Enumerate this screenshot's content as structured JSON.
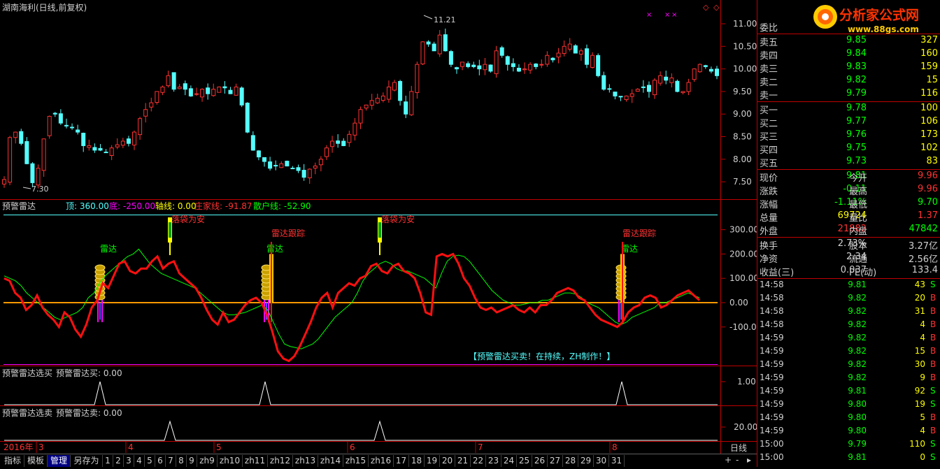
{
  "main_title": "湖南海利(日线,前复权)",
  "price_axis": [
    "11.00",
    "10.50",
    "10.00",
    "9.50",
    "9.00",
    "8.50",
    "8.00",
    "7.50"
  ],
  "price_high_label": "11.21",
  "price_low_label": "7.30",
  "radar": {
    "name": "预警雷达",
    "top_label": "顶: 360.00",
    "bottom_label": "底: -250.00",
    "axis_line_label": "轴线: 0.00",
    "dealer_label": "庄家线: -91.87",
    "retail_label": "散户线: -52.90",
    "axis": [
      "300.00",
      "200.00",
      "100.00",
      "0.00",
      "-100.00"
    ],
    "annotations": {
      "safe": "落袋为安",
      "track": "雷达跟踪",
      "radar": "雷达"
    },
    "banner": "【预警雷达买卖！在持续，ZH制作！】"
  },
  "buy_panel": {
    "name": "预警雷达选买",
    "value_label": "预警雷达买: 0.00",
    "axis": "1.00"
  },
  "sell_panel": {
    "name": "预警雷达选卖",
    "value_label": "预警雷达卖: 0.00",
    "axis": "20.00"
  },
  "date_axis": {
    "year": "2016年",
    "months": [
      "3",
      "4",
      "5",
      "6",
      "7",
      "8"
    ],
    "period": "日线"
  },
  "tabs": [
    "指标",
    "模板",
    "管理",
    "另存为",
    "1",
    "2",
    "3",
    "4",
    "5",
    "6",
    "7",
    "8",
    "9",
    "zh9",
    "zh10",
    "zh11",
    "zh12",
    "zh13",
    "zh14",
    "zh15",
    "zh16",
    "17",
    "18",
    "19",
    "20",
    "21",
    "22",
    "23",
    "24",
    "25",
    "26",
    "27",
    "28",
    "29",
    "30",
    "31"
  ],
  "logo": {
    "title": "分析家公式网",
    "url": "www.88gs.com"
  },
  "quote": {
    "header": "委比",
    "sells": [
      {
        "label": "卖五",
        "price": "9.85",
        "vol": "327"
      },
      {
        "label": "卖四",
        "price": "9.84",
        "vol": "160"
      },
      {
        "label": "卖三",
        "price": "9.83",
        "vol": "159"
      },
      {
        "label": "卖二",
        "price": "9.82",
        "vol": "15"
      },
      {
        "label": "卖一",
        "price": "9.79",
        "vol": "116"
      }
    ],
    "buys": [
      {
        "label": "买一",
        "price": "9.78",
        "vol": "100"
      },
      {
        "label": "买二",
        "price": "9.77",
        "vol": "106"
      },
      {
        "label": "买三",
        "price": "9.76",
        "vol": "173"
      },
      {
        "label": "买四",
        "price": "9.75",
        "vol": "102"
      },
      {
        "label": "买五",
        "price": "9.73",
        "vol": "83"
      }
    ],
    "stats": [
      {
        "l1": "现价",
        "v1": "9.81",
        "l2": "今开",
        "v2": "9.96"
      },
      {
        "l1": "涨跌",
        "v1": "-0.11",
        "l2": "最高",
        "v2": "9.96"
      },
      {
        "l1": "涨幅",
        "v1": "-1.11%",
        "l2": "最低",
        "v2": "9.70"
      },
      {
        "l1": "总量",
        "v1": "69724",
        "l2": "量比",
        "v2": "1.37"
      },
      {
        "l1": "外盘",
        "v1": "21882",
        "l2": "内盘",
        "v2": "47842"
      }
    ],
    "finance": [
      {
        "l1": "换手",
        "v1": "2.73%",
        "l2": "股本",
        "v2": "3.27亿"
      },
      {
        "l1": "净资",
        "v1": "2.34",
        "l2": "流通",
        "v2": "2.56亿"
      },
      {
        "l1": "收益(三)",
        "v1": "0.037",
        "l2": "PE(动)",
        "v2": "133.4"
      }
    ],
    "ticks": [
      {
        "time": "14:58",
        "price": "9.81",
        "vol": "43",
        "side": "S"
      },
      {
        "time": "14:58",
        "price": "9.82",
        "vol": "20",
        "side": "B"
      },
      {
        "time": "14:58",
        "price": "9.82",
        "vol": "31",
        "side": "B"
      },
      {
        "time": "14:58",
        "price": "9.82",
        "vol": "4",
        "side": "B"
      },
      {
        "time": "14:59",
        "price": "9.82",
        "vol": "4",
        "side": "B"
      },
      {
        "time": "14:59",
        "price": "9.82",
        "vol": "15",
        "side": "B"
      },
      {
        "time": "14:59",
        "price": "9.82",
        "vol": "30",
        "side": "B"
      },
      {
        "time": "14:59",
        "price": "9.82",
        "vol": "9",
        "side": "B"
      },
      {
        "time": "14:59",
        "price": "9.81",
        "vol": "92",
        "side": "S"
      },
      {
        "time": "14:59",
        "price": "9.80",
        "vol": "19",
        "side": "S"
      },
      {
        "time": "14:59",
        "price": "9.80",
        "vol": "5",
        "side": "B"
      },
      {
        "time": "14:59",
        "price": "9.80",
        "vol": "4",
        "side": "B"
      },
      {
        "time": "15:00",
        "price": "9.79",
        "vol": "110",
        "side": "S"
      },
      {
        "time": "15:00",
        "price": "9.81",
        "vol": "0",
        "side": "S"
      }
    ]
  },
  "colors": {
    "up": "#ff3232",
    "down": "#54ffff",
    "grid": "#c00000",
    "white_line": "#ffffff",
    "green": "#00ff00",
    "yellow": "#ffff00",
    "magenta": "#ff00ff"
  }
}
